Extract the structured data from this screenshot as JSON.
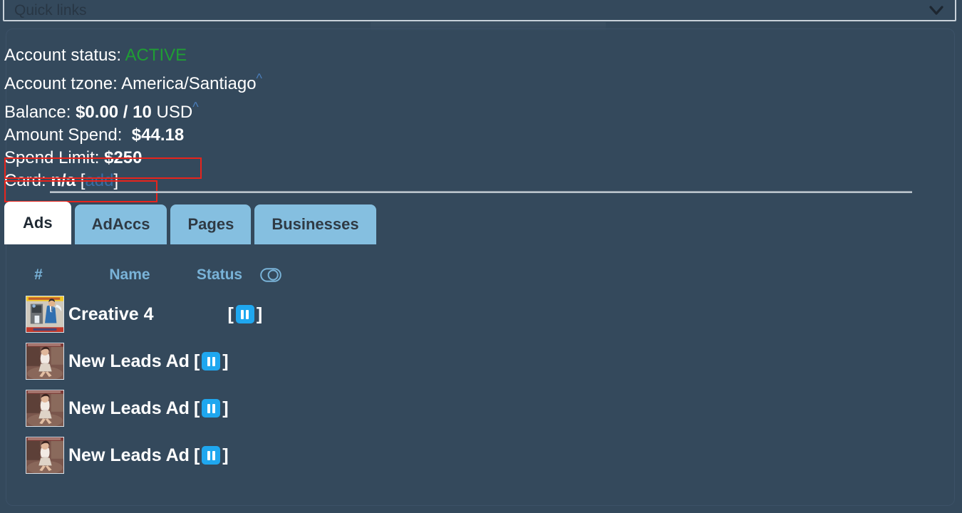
{
  "quick_links": {
    "label": "Quick links",
    "chevron_icon": "chevron-down-icon"
  },
  "account": {
    "status_label": "Account status:",
    "status_value": "ACTIVE",
    "status_color": "#1f9e34",
    "tzone_label": "Account tzone:",
    "tzone_value": "America/Santiago",
    "tzone_caret": "^",
    "balance_label": "Balance:",
    "balance_value": "$0.00 / 10",
    "balance_currency": "USD",
    "balance_caret": "^",
    "amount_spend_label": "Amount Spend:",
    "amount_spend_value": "$44.18",
    "spend_limit_label": "Spend Limit:",
    "spend_limit_value": "$250",
    "card_label": "Card:",
    "card_value": "n/a",
    "card_bracket_open": "[",
    "card_add_link": "add",
    "card_bracket_close": "]",
    "annotation_color": "#e8241c"
  },
  "tabs": [
    {
      "label": "Ads",
      "active": true
    },
    {
      "label": "AdAccs",
      "active": false
    },
    {
      "label": "Pages",
      "active": false
    },
    {
      "label": "Businesses",
      "active": false
    }
  ],
  "table": {
    "headers": {
      "hash": "#",
      "name": "Name",
      "status": "Status",
      "toggle_icon": "toggle-switch-icon"
    },
    "rows": [
      {
        "name": "Creative 4",
        "status_icon": "pause-icon",
        "bracket_open": "[",
        "bracket_close": "]",
        "thumb": "creative-4-thumbnail"
      },
      {
        "name": "New Leads Ad",
        "status_icon": "pause-icon",
        "bracket_open": "[",
        "bracket_close": "]",
        "thumb": "new-leads-ad-thumbnail-1"
      },
      {
        "name": "New Leads Ad",
        "status_icon": "pause-icon",
        "bracket_open": "[",
        "bracket_close": "]",
        "thumb": "new-leads-ad-thumbnail-2"
      },
      {
        "name": "New Leads Ad",
        "status_icon": "pause-icon",
        "bracket_open": "[",
        "bracket_close": "]",
        "thumb": "new-leads-ad-thumbnail-3"
      }
    ]
  },
  "colors": {
    "background": "#34495c",
    "tab_inactive": "#85bfe0",
    "tab_active": "#ffffff",
    "header_text": "#79b3d8",
    "pause_button": "#1fa7ef",
    "link": "#3a6ea5"
  }
}
